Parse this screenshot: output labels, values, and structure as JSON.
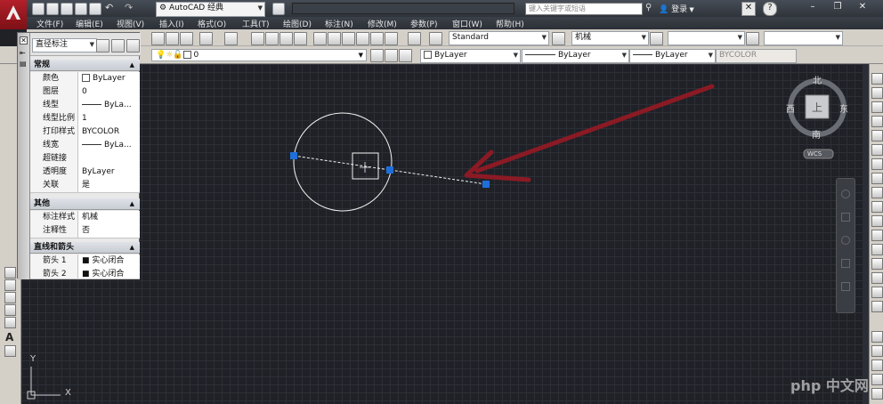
{
  "app": {
    "workspace": "AutoCAD 经典",
    "search_placeholder": "键入关键字或短语",
    "sign_in": "登录",
    "help_glyph": "?"
  },
  "menu": [
    "文件(F)",
    "编辑(E)",
    "视图(V)",
    "插入(I)",
    "格式(O)",
    "工具(T)",
    "绘图(D)",
    "标注(N)",
    "修改(M)",
    "参数(P)",
    "窗口(W)",
    "帮助(H)"
  ],
  "styles_toolbar": {
    "text_style": "Standard",
    "dim_style": "机械"
  },
  "layers_toolbar": {
    "current_layer": "0",
    "color": "ByLayer",
    "linetype": "ByLayer",
    "lineweight": "ByLayer",
    "plot_style": "BYCOLOR"
  },
  "properties": {
    "object_type": "直径标注",
    "sections": [
      {
        "title": "常规",
        "rows": [
          {
            "key": "颜色",
            "value": "ByLayer",
            "kind": "color"
          },
          {
            "key": "图层",
            "value": "0"
          },
          {
            "key": "线型",
            "value": "ByLa...",
            "kind": "line"
          },
          {
            "key": "线型比例",
            "value": "1"
          },
          {
            "key": "打印样式",
            "value": "BYCOLOR"
          },
          {
            "key": "线宽",
            "value": "ByLa...",
            "kind": "line"
          },
          {
            "key": "超链接",
            "value": ""
          },
          {
            "key": "透明度",
            "value": "ByLayer"
          },
          {
            "key": "关联",
            "value": "是"
          }
        ]
      },
      {
        "title": "其他",
        "rows": [
          {
            "key": "标注样式",
            "value": "机械"
          },
          {
            "key": "注释性",
            "value": "否"
          }
        ]
      },
      {
        "title": "直线和箭头",
        "rows": [
          {
            "key": "箭头 1",
            "value": "实心闭合"
          },
          {
            "key": "箭头 2",
            "value": "实心闭合"
          }
        ]
      }
    ]
  },
  "viewcube": {
    "north": "北",
    "south": "南",
    "east": "东",
    "west": "西",
    "face": "上",
    "ucs": "WCS"
  },
  "ucs_icon": {
    "x": "X",
    "y": "Y"
  },
  "watermark": "php 中文网",
  "colors": {
    "arrow": "#8b1a24",
    "grip": "#1e6fd9",
    "geometry": "#f2f2f2",
    "background": "#1f2127"
  }
}
